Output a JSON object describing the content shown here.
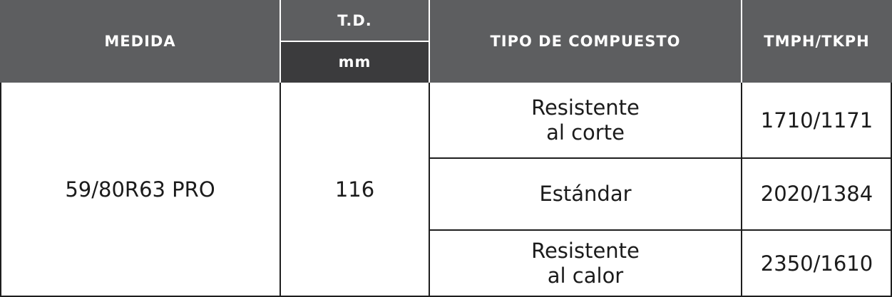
{
  "header": {
    "medida": "MEDIDA",
    "td": "T.D.",
    "td_unit": "mm",
    "tipo": "TIPO DE COMPUESTO",
    "tmph": "TMPH/TKPH"
  },
  "row": {
    "medida": "59/80R63 PRO",
    "td": "116",
    "compuestos": [
      {
        "tipo_line1": "Resistente",
        "tipo_line2": "al corte",
        "tmph": "1710/1171"
      },
      {
        "tipo_line1": "Estándar",
        "tipo_line2": "",
        "tmph": "2020/1384"
      },
      {
        "tipo_line1": "Resistente",
        "tipo_line2": "al calor",
        "tmph": "2350/1610"
      }
    ]
  }
}
